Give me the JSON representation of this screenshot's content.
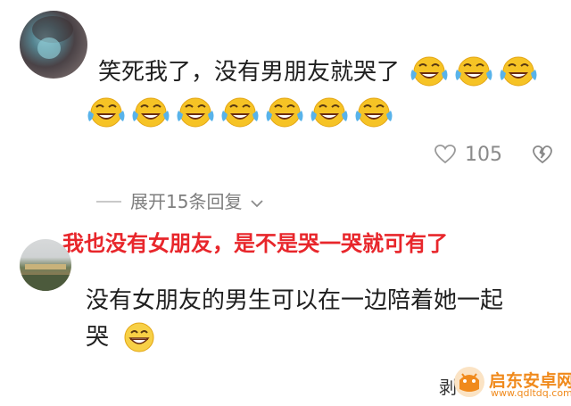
{
  "comment": {
    "text": "笑死我了，没有男朋友就哭了",
    "emoji": "laughing-tears-emoji",
    "emoji_count_line1": 3,
    "emoji_count_line2": 7,
    "like_count": "105"
  },
  "replies_toggle": {
    "label": "展开15条回复"
  },
  "overlay_caption": {
    "text": "我也没有女朋友，是不是哭一哭就可有了",
    "color": "#e8262b"
  },
  "reply": {
    "line1": "没有女朋友的男生可以在一边陪着她一起",
    "line2": "哭",
    "emoji": "grinning-emoji"
  },
  "watermark": {
    "brand": "启东安卓网",
    "url": "www.qdltdq.com",
    "cut_char": "剥",
    "color": "#f08a1c"
  }
}
